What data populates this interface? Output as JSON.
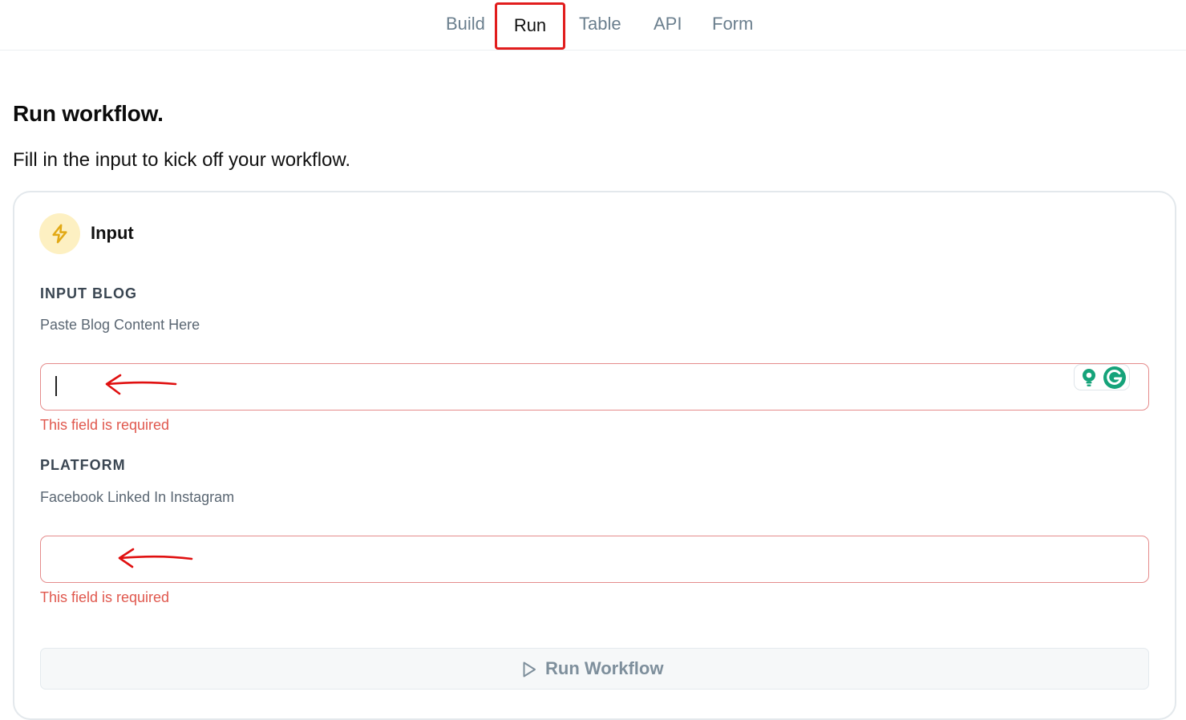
{
  "nav": {
    "tabs": [
      {
        "label": "Build"
      },
      {
        "label": "Run"
      },
      {
        "label": "Table"
      },
      {
        "label": "API"
      },
      {
        "label": "Form"
      }
    ],
    "active_index": 1
  },
  "page": {
    "title": "Run workflow.",
    "subtitle": "Fill in the input to kick off your workflow."
  },
  "card": {
    "header_label": "Input",
    "header_icon": "lightning-bolt-icon",
    "fields": [
      {
        "label": "INPUT BLOG",
        "description": "Paste Blog Content Here",
        "value": "",
        "error": "This field is required"
      },
      {
        "label": "PLATFORM",
        "description": "Facebook Linked In Instagram",
        "value": "",
        "error": "This field is required"
      }
    ],
    "run_button_label": "Run Workflow"
  },
  "colors": {
    "active_tab_outline": "#e11d1d",
    "error_text": "#e0584e",
    "field_border_error": "#e58c8c",
    "annotation_arrow": "#e01010",
    "icon_badge_bg": "#fdf0c2",
    "icon_badge_fg": "#e2a915",
    "grammarly_green": "#15a37a"
  }
}
